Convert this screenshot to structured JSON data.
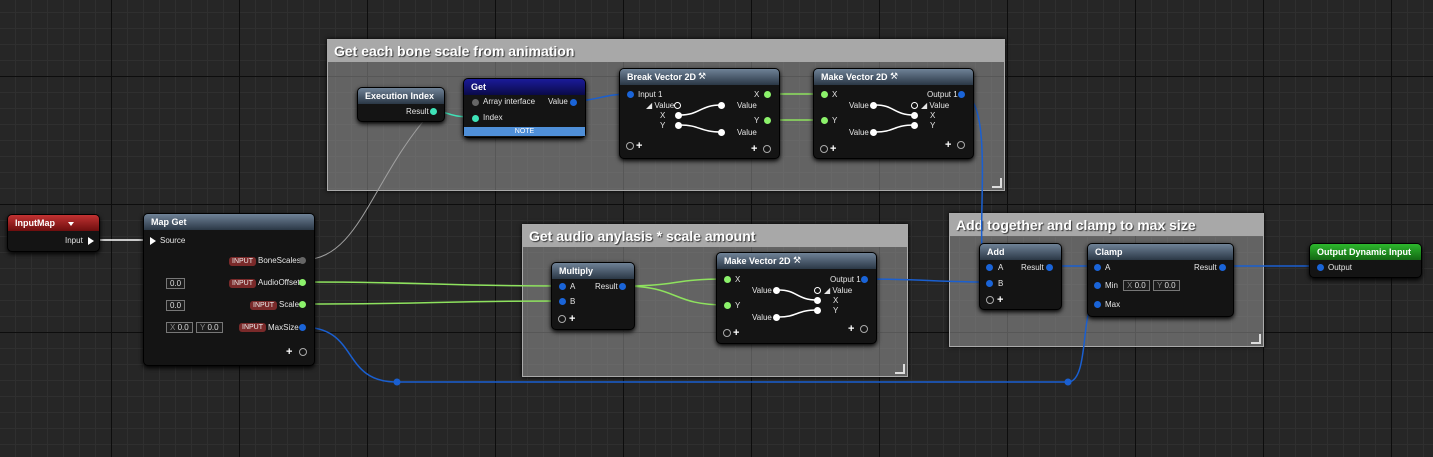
{
  "comments": {
    "bone": "Get each bone scale from animation",
    "audio": "Get audio anylasis * scale amount",
    "clamp": "Add together and clamp to max size"
  },
  "input_map": {
    "title": "InputMap",
    "dropdown_icon": "triangle-down-icon",
    "pin": "Input"
  },
  "map_get": {
    "title": "Map Get",
    "source": "Source",
    "badge": "INPUT",
    "bone_scales": "BoneScales",
    "audio_offset": "AudioOffset",
    "audio_offset_value": "0.0",
    "scale": "Scale",
    "scale_value": "0.0",
    "max_size": "MaxSize",
    "x_label": "X",
    "x_value": "0.0",
    "y_label": "Y",
    "y_value": "0.0"
  },
  "execution_index": {
    "title": "Execution Index",
    "result": "Result"
  },
  "get": {
    "title": "Get",
    "array": "Array interface",
    "index": "Index",
    "value": "Value",
    "note": "NOTE"
  },
  "break_vector": {
    "title": "Break Vector 2D",
    "input": "Input 1",
    "value": "Value",
    "x": "X",
    "y": "Y"
  },
  "make_vector_top": {
    "title": "Make Vector 2D",
    "x": "X",
    "y": "Y",
    "value": "Value",
    "output": "Output 1"
  },
  "multiply": {
    "title": "Multiply",
    "a": "A",
    "b": "B",
    "result": "Result"
  },
  "make_vector_mid": {
    "title": "Make Vector 2D",
    "x": "X",
    "y": "Y",
    "value": "Value",
    "output": "Output 1"
  },
  "add": {
    "title": "Add",
    "a": "A",
    "b": "B",
    "result": "Result"
  },
  "clamp": {
    "title": "Clamp",
    "a": "A",
    "min": "Min",
    "max": "Max",
    "result": "Result",
    "x_label": "X",
    "x_value": "0.0",
    "y_label": "Y",
    "y_value": "0.0"
  },
  "output": {
    "title": "Output Dynamic Input",
    "pin": "Output"
  },
  "colors": {
    "vector_wire": "#1a5fd0",
    "float_wire": "#8ee25e",
    "int_wire": "#3fe3b8",
    "exec_wire": "#ffffff"
  }
}
